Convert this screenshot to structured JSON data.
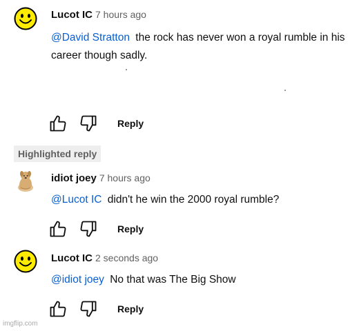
{
  "comments": [
    {
      "author": "Lucot IC",
      "time": "7 hours ago",
      "mention": "@David Stratton",
      "text": "the rock has never won a royal rumble in his career though sadly.",
      "reply_label": "Reply",
      "avatar_icon": "smiley-face-avatar"
    },
    {
      "author": "idiot joey",
      "time": "7 hours ago",
      "mention": "@Lucot IC",
      "text": "didn't he win the 2000 royal rumble?",
      "reply_label": "Reply",
      "avatar_icon": "dog-avatar"
    },
    {
      "author": "Lucot IC",
      "time": "2 seconds ago",
      "mention": "@idiot joey",
      "text": "No that was The Big Show",
      "reply_label": "Reply",
      "avatar_icon": "smiley-face-avatar"
    }
  ],
  "highlighted_label": "Highlighted reply",
  "watermark": "imgflip.com",
  "colors": {
    "mention": "#065fd4",
    "badge_bg": "#eeeeee",
    "smiley_yellow": "#ffeb00"
  },
  "icons": {
    "like": "thumbs-up-icon",
    "dislike": "thumbs-down-icon"
  }
}
